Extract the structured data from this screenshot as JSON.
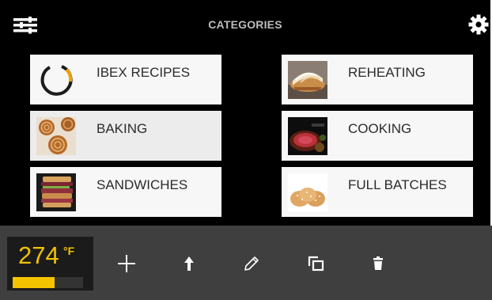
{
  "header": {
    "title": "CATEGORIES",
    "menu_icon": "sliders-icon",
    "settings_icon": "gear-icon"
  },
  "categories": [
    {
      "label": "IBEX RECIPES",
      "thumbnail": "ibex-logo-icon"
    },
    {
      "label": "REHEATING",
      "thumbnail": "reheated-sandwich-photo"
    },
    {
      "label": "BAKING",
      "thumbnail": "cinnamon-rolls-photo"
    },
    {
      "label": "COOKING",
      "thumbnail": "roast-beef-photo"
    },
    {
      "label": "SANDWICHES",
      "thumbnail": "stacked-sandwich-photo"
    },
    {
      "label": "FULL BATCHES",
      "thumbnail": "bread-rolls-photo"
    }
  ],
  "toolbar": {
    "temperature": "274",
    "temperature_unit": "°F",
    "temperature_level": 0.6,
    "actions": [
      "add-icon",
      "upload-icon",
      "edit-icon",
      "copy-icon",
      "delete-icon"
    ]
  },
  "colors": {
    "accent": "#f5c400",
    "panel_background": "#000000",
    "toolbar_background": "#3f3f3f",
    "title_text": "#bdbdbd"
  }
}
